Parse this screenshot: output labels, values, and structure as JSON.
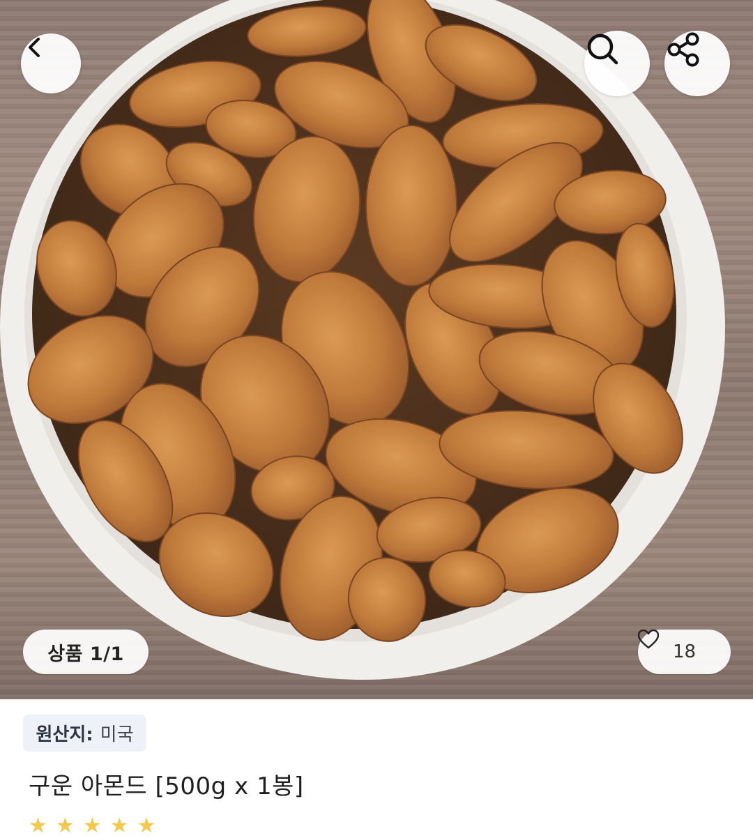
{
  "hero": {
    "image_alt": "almonds in a white bowl",
    "counter": "상품 1/1",
    "like_count": "18"
  },
  "icons": {
    "back": "chevron-left-icon",
    "search": "search-icon",
    "share": "share-icon",
    "heart": "heart-outline-icon",
    "star": "star-icon"
  },
  "product": {
    "origin_label": "원산지:",
    "origin_value": "미국",
    "title": "구운 아몬드 [500g x 1봉]"
  },
  "colors": {
    "star": "#f2c94c",
    "tag_bg": "#eef1f7"
  }
}
